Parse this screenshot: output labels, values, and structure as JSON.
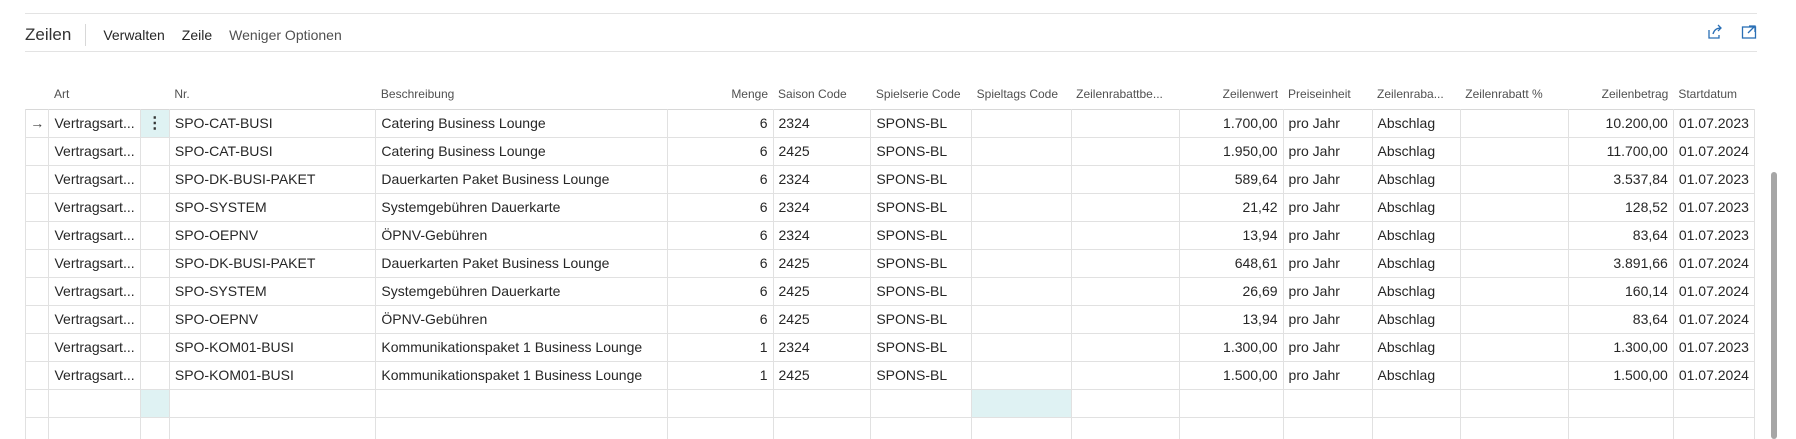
{
  "toolbar": {
    "title": "Zeilen",
    "items": [
      "Verwalten",
      "Zeile",
      "Weniger Optionen"
    ]
  },
  "grid": {
    "columns": {
      "art": "Art",
      "nr": "Nr.",
      "beschreibung": "Beschreibung",
      "menge": "Menge",
      "saison": "Saison Code",
      "spielserie": "Spielserie Code",
      "spieltag": "Spieltags Code",
      "zeilenrabattbe": "Zeilenrabattbe...",
      "zeilenwert": "Zeilenwert",
      "preiseinheit": "Preiseinheit",
      "zeilenraba": "Zeilenraba...",
      "zeilenrabattpct": "Zeilenrabatt %",
      "zeilenbetrag": "Zeilenbetrag",
      "startdatum": "Startdatum"
    },
    "rows": [
      {
        "art": "Vertragsart...",
        "nr": "SPO-CAT-BUSI",
        "beschreibung": "Catering Business Lounge",
        "menge": "6",
        "saison": "2324",
        "spielserie": "SPONS-BL",
        "spieltag": "",
        "zeilenrabattbe": "",
        "zeilenwert": "1.700,00",
        "preiseinheit": "pro Jahr",
        "zeilenraba": "Abschlag",
        "zeilenrabattpct": "",
        "zeilenbetrag": "10.200,00",
        "startdatum": "01.07.2023"
      },
      {
        "art": "Vertragsart...",
        "nr": "SPO-CAT-BUSI",
        "beschreibung": "Catering Business Lounge",
        "menge": "6",
        "saison": "2425",
        "spielserie": "SPONS-BL",
        "spieltag": "",
        "zeilenrabattbe": "",
        "zeilenwert": "1.950,00",
        "preiseinheit": "pro Jahr",
        "zeilenraba": "Abschlag",
        "zeilenrabattpct": "",
        "zeilenbetrag": "11.700,00",
        "startdatum": "01.07.2024"
      },
      {
        "art": "Vertragsart...",
        "nr": "SPO-DK-BUSI-PAKET",
        "beschreibung": "Dauerkarten Paket Business Lounge",
        "menge": "6",
        "saison": "2324",
        "spielserie": "SPONS-BL",
        "spieltag": "",
        "zeilenrabattbe": "",
        "zeilenwert": "589,64",
        "preiseinheit": "pro Jahr",
        "zeilenraba": "Abschlag",
        "zeilenrabattpct": "",
        "zeilenbetrag": "3.537,84",
        "startdatum": "01.07.2023"
      },
      {
        "art": "Vertragsart...",
        "nr": "SPO-SYSTEM",
        "beschreibung": "Systemgebühren Dauerkarte",
        "menge": "6",
        "saison": "2324",
        "spielserie": "SPONS-BL",
        "spieltag": "",
        "zeilenrabattbe": "",
        "zeilenwert": "21,42",
        "preiseinheit": "pro Jahr",
        "zeilenraba": "Abschlag",
        "zeilenrabattpct": "",
        "zeilenbetrag": "128,52",
        "startdatum": "01.07.2023"
      },
      {
        "art": "Vertragsart...",
        "nr": "SPO-OEPNV",
        "beschreibung": "ÖPNV-Gebühren",
        "menge": "6",
        "saison": "2324",
        "spielserie": "SPONS-BL",
        "spieltag": "",
        "zeilenrabattbe": "",
        "zeilenwert": "13,94",
        "preiseinheit": "pro Jahr",
        "zeilenraba": "Abschlag",
        "zeilenrabattpct": "",
        "zeilenbetrag": "83,64",
        "startdatum": "01.07.2023"
      },
      {
        "art": "Vertragsart...",
        "nr": "SPO-DK-BUSI-PAKET",
        "beschreibung": "Dauerkarten Paket Business Lounge",
        "menge": "6",
        "saison": "2425",
        "spielserie": "SPONS-BL",
        "spieltag": "",
        "zeilenrabattbe": "",
        "zeilenwert": "648,61",
        "preiseinheit": "pro Jahr",
        "zeilenraba": "Abschlag",
        "zeilenrabattpct": "",
        "zeilenbetrag": "3.891,66",
        "startdatum": "01.07.2024"
      },
      {
        "art": "Vertragsart...",
        "nr": "SPO-SYSTEM",
        "beschreibung": "Systemgebühren Dauerkarte",
        "menge": "6",
        "saison": "2425",
        "spielserie": "SPONS-BL",
        "spieltag": "",
        "zeilenrabattbe": "",
        "zeilenwert": "26,69",
        "preiseinheit": "pro Jahr",
        "zeilenraba": "Abschlag",
        "zeilenrabattpct": "",
        "zeilenbetrag": "160,14",
        "startdatum": "01.07.2024"
      },
      {
        "art": "Vertragsart...",
        "nr": "SPO-OEPNV",
        "beschreibung": "ÖPNV-Gebühren",
        "menge": "6",
        "saison": "2425",
        "spielserie": "SPONS-BL",
        "spieltag": "",
        "zeilenrabattbe": "",
        "zeilenwert": "13,94",
        "preiseinheit": "pro Jahr",
        "zeilenraba": "Abschlag",
        "zeilenrabattpct": "",
        "zeilenbetrag": "83,64",
        "startdatum": "01.07.2024"
      },
      {
        "art": "Vertragsart...",
        "nr": "SPO-KOM01-BUSI",
        "beschreibung": "Kommunikationspaket 1 Business Lounge",
        "menge": "1",
        "saison": "2324",
        "spielserie": "SPONS-BL",
        "spieltag": "",
        "zeilenrabattbe": "",
        "zeilenwert": "1.300,00",
        "preiseinheit": "pro Jahr",
        "zeilenraba": "Abschlag",
        "zeilenrabattpct": "",
        "zeilenbetrag": "1.300,00",
        "startdatum": "01.07.2023"
      },
      {
        "art": "Vertragsart...",
        "nr": "SPO-KOM01-BUSI",
        "beschreibung": "Kommunikationspaket 1 Business Lounge",
        "menge": "1",
        "saison": "2425",
        "spielserie": "SPONS-BL",
        "spieltag": "",
        "zeilenrabattbe": "",
        "zeilenwert": "1.500,00",
        "preiseinheit": "pro Jahr",
        "zeilenraba": "Abschlag",
        "zeilenrabattpct": "",
        "zeilenbetrag": "1.500,00",
        "startdatum": "01.07.2024"
      }
    ],
    "selected_row_marker": "→",
    "row_menu_glyph": "⋮"
  }
}
